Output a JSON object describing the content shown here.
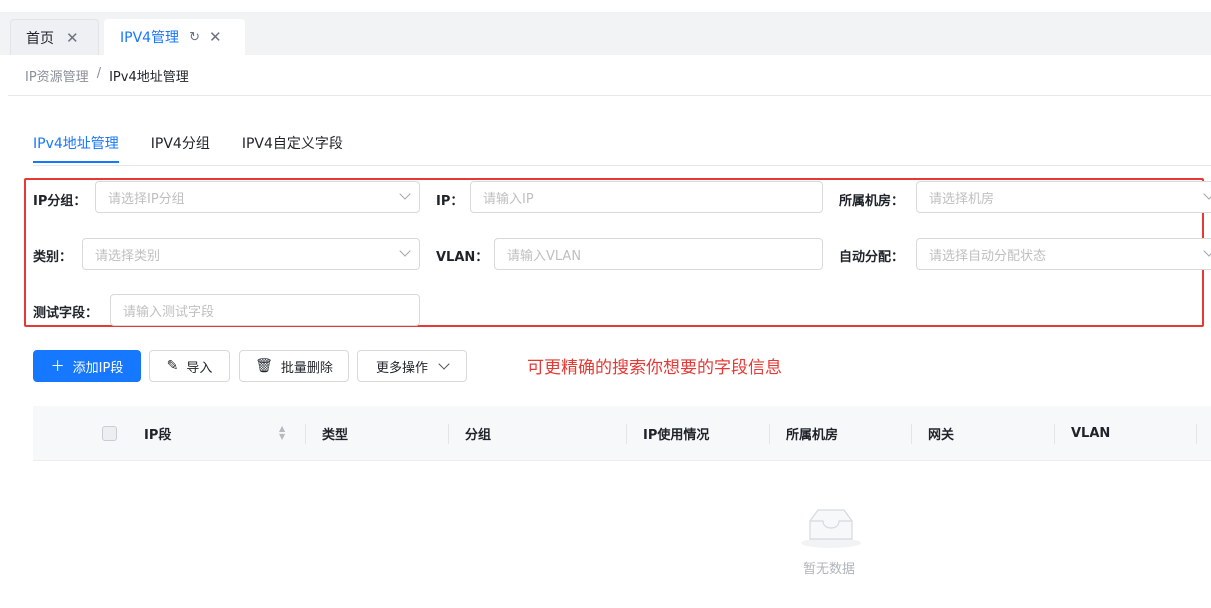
{
  "tabs": [
    {
      "label": "首页"
    },
    {
      "label": "IPV4管理"
    }
  ],
  "breadcrumb": {
    "parent": "IP资源管理",
    "separator": "/",
    "current": "IPv4地址管理"
  },
  "subtabs": [
    {
      "label": "IPv4地址管理",
      "active": true
    },
    {
      "label": "IPV4分组",
      "active": false
    },
    {
      "label": "IPV4自定义字段",
      "active": false
    }
  ],
  "filters": {
    "ip_group": {
      "label": "IP分组：",
      "placeholder": "请选择IP分组"
    },
    "ip": {
      "label": "IP：",
      "placeholder": "请输入IP"
    },
    "room": {
      "label": "所属机房：",
      "placeholder": "请选择机房"
    },
    "category": {
      "label": "类别：",
      "placeholder": "请选择类别"
    },
    "vlan": {
      "label": "VLAN：",
      "placeholder": "请输入VLAN"
    },
    "auto_assign": {
      "label": "自动分配：",
      "placeholder": "请选择自动分配状态"
    },
    "test_field": {
      "label": "测试字段：",
      "placeholder": "请输入测试字段"
    }
  },
  "toolbar": {
    "add": "添加IP段",
    "import": "导入",
    "batch_delete": "批量删除",
    "more": "更多操作"
  },
  "annotation": "可更精确的搜索你想要的字段信息",
  "table": {
    "columns": [
      "IP段",
      "类型",
      "分组",
      "IP使用情况",
      "所属机房",
      "网关",
      "VLAN"
    ],
    "empty_text": "暂无数据"
  },
  "colors": {
    "accent": "#1677ff",
    "highlight_border": "#e53935",
    "annotation": "#e53935"
  }
}
